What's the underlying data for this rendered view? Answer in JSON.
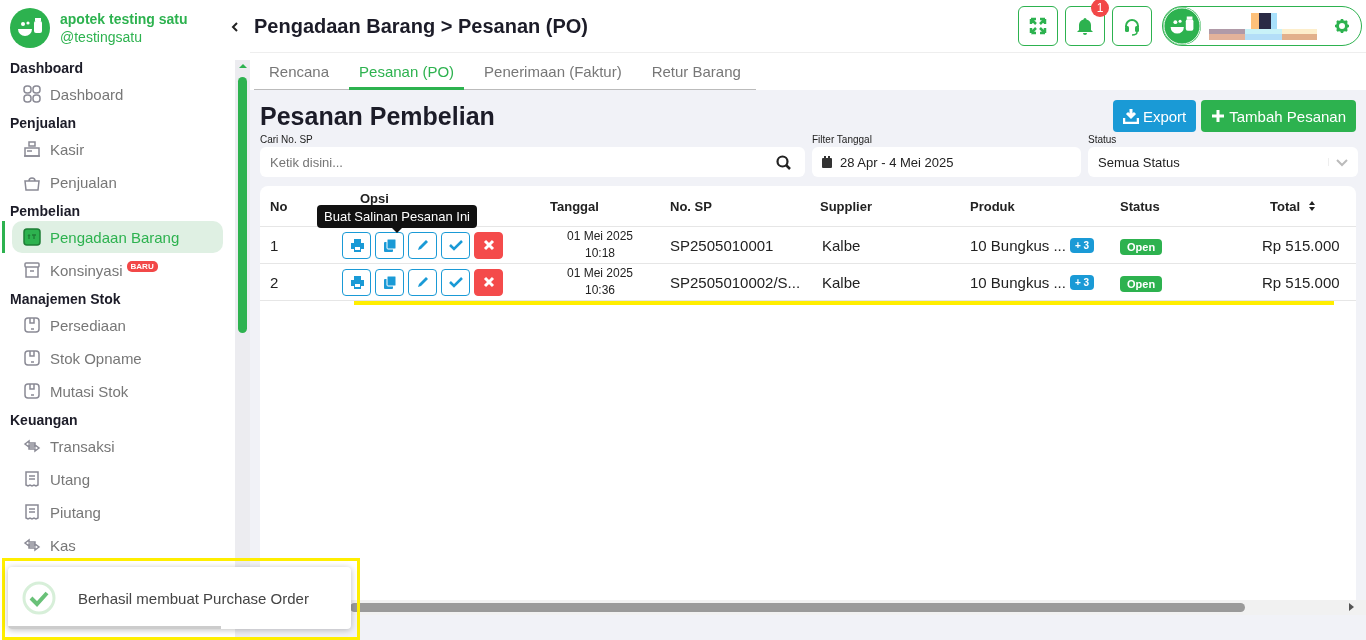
{
  "brand": {
    "name": "apotek testing satu",
    "handle": "@testingsatu"
  },
  "sidebar": {
    "sections": [
      {
        "title": "Dashboard",
        "items": [
          {
            "label": "Dashboard",
            "selected": false
          }
        ]
      },
      {
        "title": "Penjualan",
        "items": [
          {
            "label": "Kasir",
            "selected": false
          },
          {
            "label": "Penjualan",
            "selected": false
          }
        ]
      },
      {
        "title": "Pembelian",
        "items": [
          {
            "label": "Pengadaan Barang",
            "selected": true
          },
          {
            "label": "Konsinyasi",
            "selected": false,
            "badge": "BARU"
          }
        ]
      },
      {
        "title": "Manajemen Stok",
        "items": [
          {
            "label": "Persediaan",
            "selected": false
          },
          {
            "label": "Stok Opname",
            "selected": false
          },
          {
            "label": "Mutasi Stok",
            "selected": false
          }
        ]
      },
      {
        "title": "Keuangan",
        "items": [
          {
            "label": "Transaksi",
            "selected": false
          },
          {
            "label": "Utang",
            "selected": false
          },
          {
            "label": "Piutang",
            "selected": false
          },
          {
            "label": "Kas",
            "selected": false
          }
        ]
      }
    ]
  },
  "header": {
    "title": "Pengadaan Barang > Pesanan (PO)",
    "notification_count": "1"
  },
  "tabs": [
    {
      "label": "Rencana",
      "selected": false
    },
    {
      "label": "Pesanan (PO)",
      "selected": true
    },
    {
      "label": "Penerimaan (Faktur)",
      "selected": false
    },
    {
      "label": "Retur Barang",
      "selected": false
    }
  ],
  "page": {
    "title": "Pesanan Pembelian",
    "buttons": [
      {
        "label": "Export",
        "kind": "export"
      },
      {
        "label": "Tambah Pesanan",
        "kind": "add"
      }
    ]
  },
  "filters": {
    "search": {
      "label": "Cari No. SP",
      "placeholder": "Ketik disini..."
    },
    "date": {
      "label": "Filter Tanggal",
      "value": "28 Apr - 4 Mei 2025"
    },
    "status": {
      "label": "Status",
      "value": "Semua Status"
    }
  },
  "table": {
    "columns": [
      {
        "label": "No",
        "sortable": false
      },
      {
        "label": "Opsi",
        "sortable": false
      },
      {
        "label": "Tanggal",
        "sortable": false
      },
      {
        "label": "No. SP",
        "sortable": false
      },
      {
        "label": "Supplier",
        "sortable": false
      },
      {
        "label": "Produk",
        "sortable": false
      },
      {
        "label": "Status",
        "sortable": false
      },
      {
        "label": "Total",
        "sortable": true
      }
    ],
    "rows": [
      {
        "no": "1",
        "date": "01 Mei 2025",
        "time": "10:18",
        "sp": "SP2505010001",
        "supplier": "Kalbe",
        "product": "10 Bungkus ...",
        "more": "+ 3",
        "status": "Open",
        "total": "Rp 515.000"
      },
      {
        "no": "2",
        "date": "01 Mei 2025",
        "time": "10:36",
        "sp": "SP2505010002/S...",
        "supplier": "Kalbe",
        "product": "10 Bungkus ...",
        "more": "+ 3",
        "status": "Open",
        "total": "Rp 515.000"
      }
    ]
  },
  "tooltip": "Buat Salinan Pesanan Ini",
  "toast": {
    "message": "Berhasil membuat Purchase Order",
    "level": 0.62
  }
}
